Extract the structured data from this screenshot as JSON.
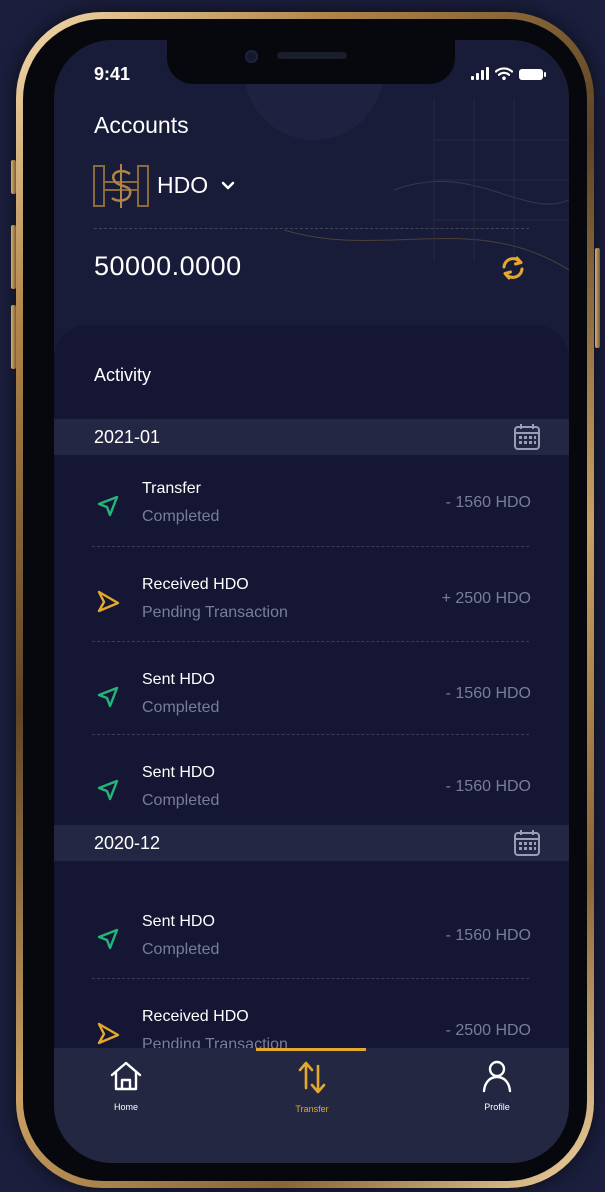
{
  "status_bar": {
    "time": "9:41"
  },
  "header": {
    "title": "Accounts",
    "account_name": "HDO",
    "balance": "50000.0000"
  },
  "activity": {
    "title": "Activity",
    "groups": [
      {
        "date": "2021-01",
        "transactions": [
          {
            "title": "Transfer",
            "status": "Completed",
            "amount": "- 1560 HDO",
            "kind": "sent"
          },
          {
            "title": "Received HDO",
            "status": "Pending Transaction",
            "amount": "+ 2500 HDO",
            "kind": "received"
          },
          {
            "title": "Sent HDO",
            "status": "Completed",
            "amount": "- 1560 HDO",
            "kind": "sent"
          },
          {
            "title": "Sent HDO",
            "status": "Completed",
            "amount": "- 1560 HDO",
            "kind": "sent"
          }
        ]
      },
      {
        "date": "2020-12",
        "transactions": [
          {
            "title": "Sent HDO",
            "status": "Completed",
            "amount": "- 1560 HDO",
            "kind": "sent"
          },
          {
            "title": "Received HDO",
            "status": "Pending Transaction",
            "amount": "- 2500 HDO",
            "kind": "received"
          }
        ]
      }
    ]
  },
  "tabbar": {
    "tabs": [
      {
        "label": "Home",
        "icon": "home-icon",
        "active": false
      },
      {
        "label": "Transfer",
        "icon": "transfer-icon",
        "active": true
      },
      {
        "label": "Profile",
        "icon": "profile-icon",
        "active": false
      }
    ]
  },
  "colors": {
    "accent": "#e4a92c",
    "sent_arrow": "#25b57a",
    "received_arrow": "#e4a92c",
    "background": "#191c38",
    "panel": "#141633",
    "muted_text": "#7a7d9a"
  }
}
